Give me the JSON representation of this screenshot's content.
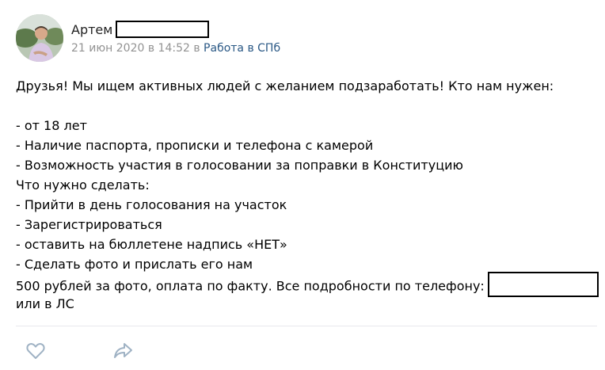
{
  "post": {
    "author": {
      "name": "Артем"
    },
    "meta": {
      "date": "21 июн 2020 в 14:52",
      "connector": " в ",
      "group": "Работа в СПб"
    },
    "body": {
      "lines": [
        "Друзья! Мы ищем активных людей с желанием подзаработать! Кто нам нужен:",
        "",
        "- от 18 лет",
        "- Наличие паспорта, прописки и телефона с камерой",
        "- Возможность участия в голосовании за поправки в Конституцию",
        "Что нужно сделать:",
        "- Прийти в день голосования на участок",
        "- Зарегистрироваться",
        "- оставить на бюллетене надпись «НЕТ»",
        "- Сделать фото и прислать его нам",
        "500 рублей за фото, оплата по факту. Все подробности по телефону:",
        "или в ЛС"
      ]
    },
    "actions": {
      "like_icon": "heart-outline-icon",
      "share_icon": "share-arrow-icon"
    },
    "colors": {
      "link": "#2a5885",
      "meta": "#939393",
      "icon": "#9fb2c4",
      "divider": "#e7e8ec"
    }
  }
}
